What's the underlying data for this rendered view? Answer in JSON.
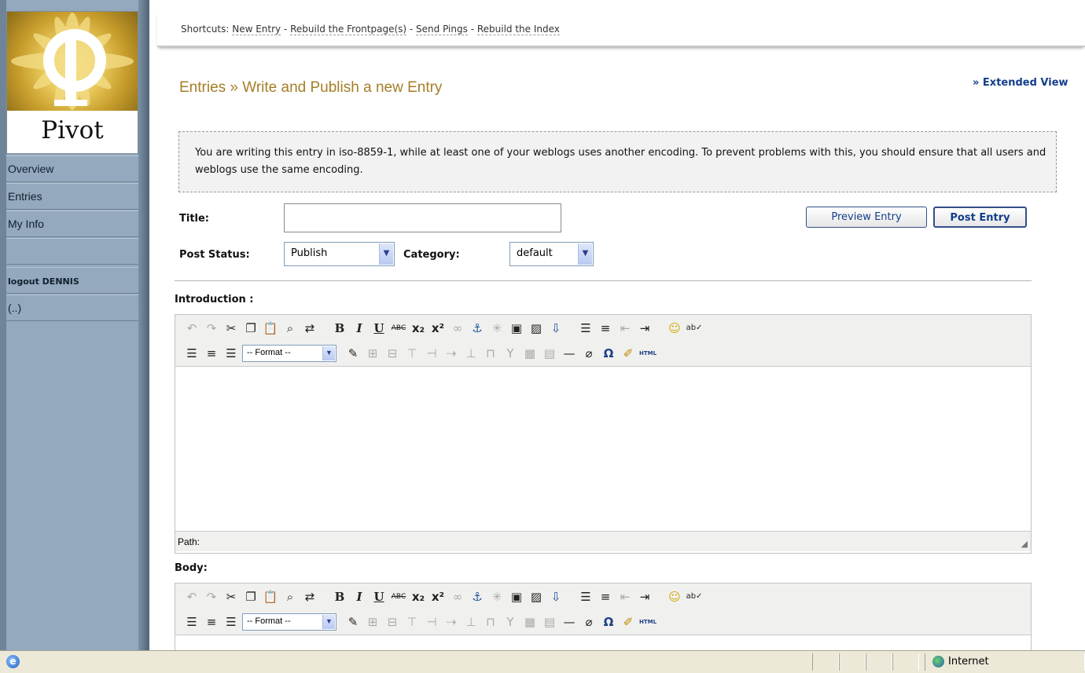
{
  "sidebar": {
    "logo_text": "Pivot",
    "items": [
      {
        "label": "Overview"
      },
      {
        "label": "Entries"
      },
      {
        "label": "My Info"
      },
      {
        "label": ""
      },
      {
        "label": "logout DENNIS"
      },
      {
        "label": "(..)"
      }
    ]
  },
  "shortcuts": {
    "prefix": "Shortcuts:",
    "links": [
      "New Entry",
      "Rebuild the Frontpage(s)",
      "Send Pings",
      "Rebuild the Index"
    ],
    "separator": " - "
  },
  "header": {
    "title": "Entries » Write and Publish a new Entry",
    "extended_view": "» Extended View"
  },
  "notice": {
    "text": "You are writing this entry in iso-8859-1, while at least one of your weblogs uses another encoding. To prevent problems with this, you should ensure that all users and weblogs use the same encoding."
  },
  "form": {
    "title_label": "Title:",
    "title_value": "",
    "post_status_label": "Post Status:",
    "post_status_value": "Publish",
    "category_label": "Category:",
    "category_value": "default",
    "preview_button": "Preview Entry",
    "post_button": "Post Entry"
  },
  "introduction": {
    "label": "Introduction :",
    "format_select": "-- Format --",
    "path_label": "Path:"
  },
  "body": {
    "label": "Body:",
    "format_select": "-- Format --"
  },
  "toolbar_icons": {
    "row1": [
      "undo-icon",
      "redo-icon",
      "cut-icon",
      "copy-icon",
      "paste-icon",
      "find-icon",
      "replace-icon",
      "bold-icon",
      "italic-icon",
      "underline-icon",
      "strikethrough-icon",
      "subscript-icon",
      "superscript-icon",
      "link-icon",
      "anchor-icon",
      "unlink-icon",
      "image-icon",
      "image-popup-icon",
      "insert-file-icon",
      "bullet-list-icon",
      "numbered-list-icon",
      "outdent-icon",
      "indent-icon",
      "emoticon-icon",
      "spellcheck-icon"
    ],
    "row2": [
      "align-left-icon",
      "align-center-icon",
      "align-right-icon",
      "format-select",
      "edit-icon",
      "table-icon",
      "table-props-icon",
      "insert-row-icon",
      "insert-col-icon",
      "split-icon",
      "merge-icon",
      "col-before-icon",
      "col-after-icon",
      "cell-props-icon",
      "table-row-icon",
      "horizontal-rule-icon",
      "remove-format-icon",
      "omega-icon",
      "cleanup-icon",
      "html-icon"
    ]
  },
  "statusbar": {
    "zone": "Internet"
  }
}
